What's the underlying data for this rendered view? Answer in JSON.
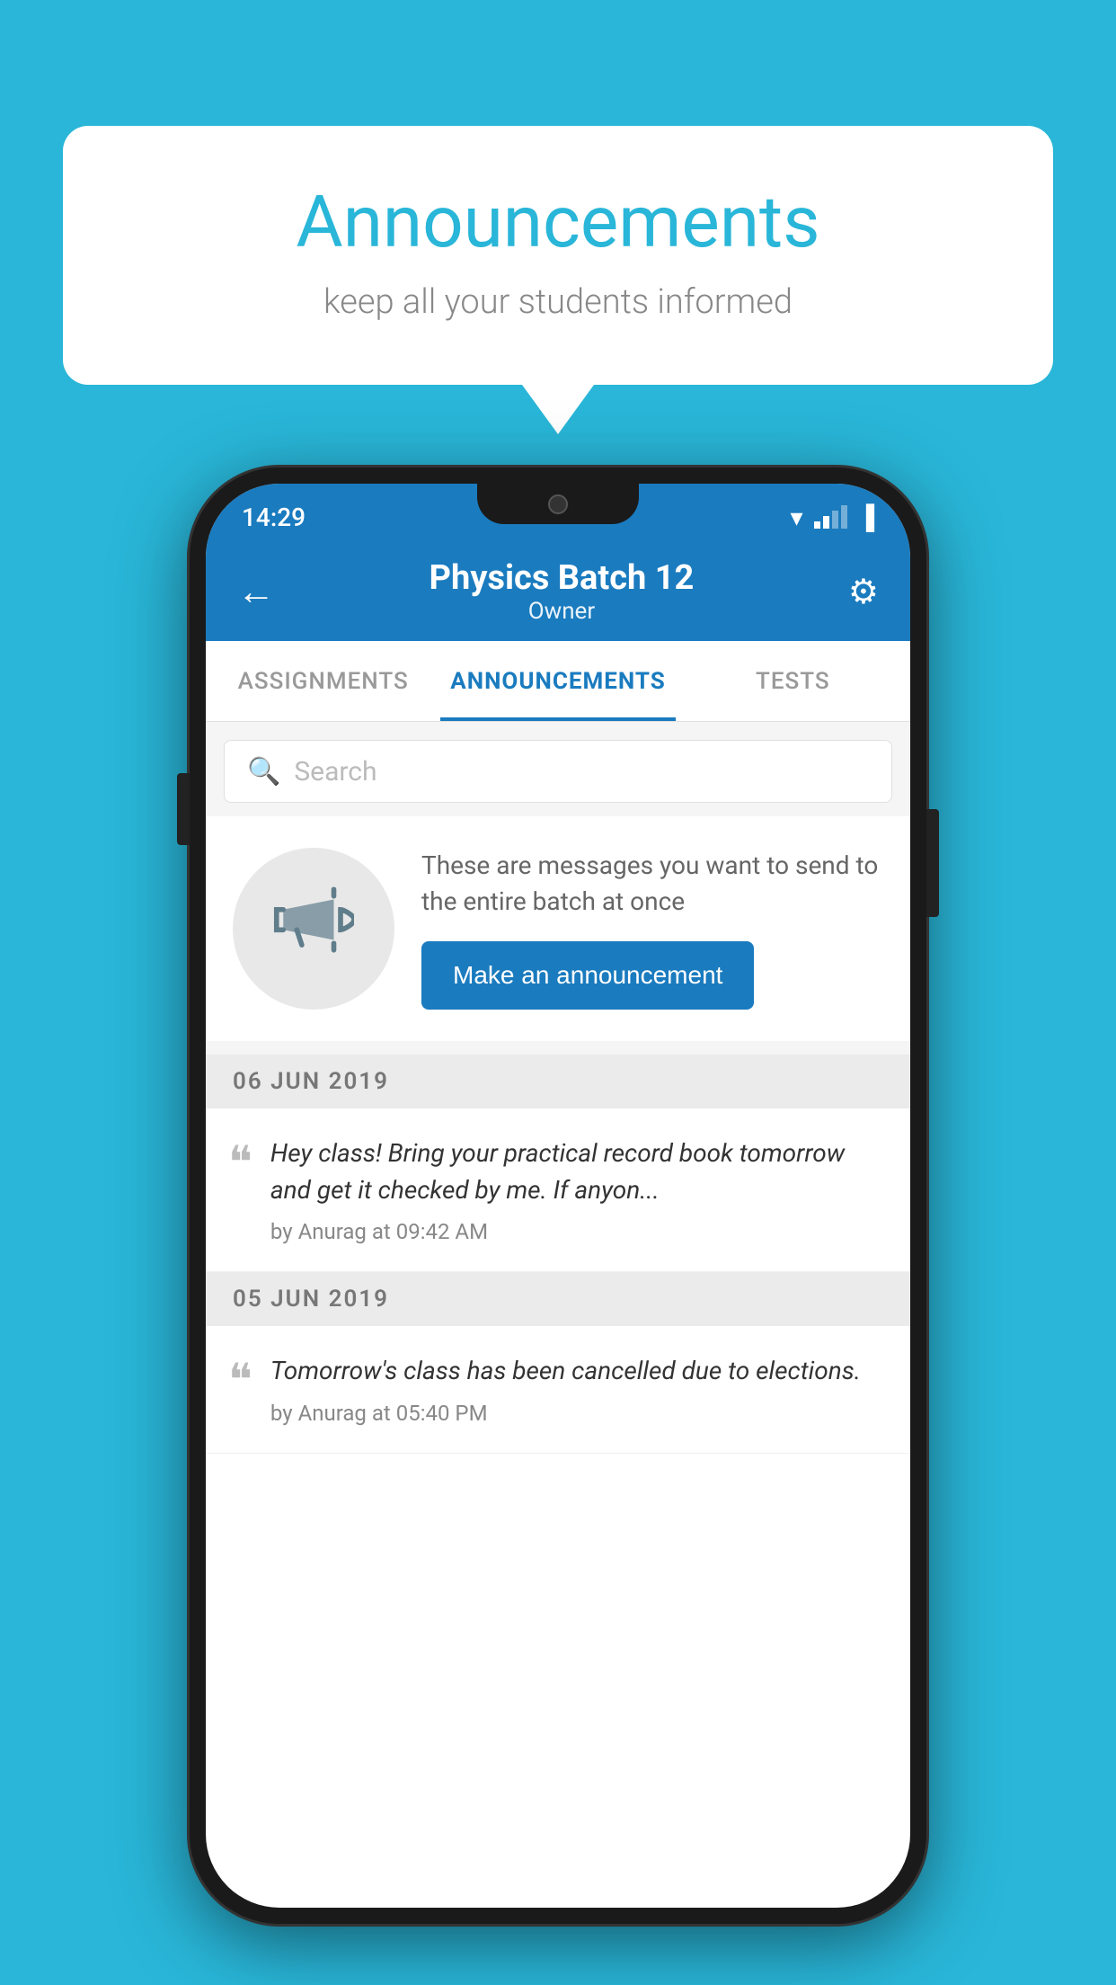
{
  "background_color": "#29b6d8",
  "speech_bubble": {
    "title": "Announcements",
    "subtitle": "keep all your students informed"
  },
  "phone": {
    "status_bar": {
      "time": "14:29"
    },
    "header": {
      "title": "Physics Batch 12",
      "subtitle": "Owner",
      "back_label": "←",
      "gear_label": "⚙"
    },
    "tabs": [
      {
        "label": "ASSIGNMENTS",
        "active": false
      },
      {
        "label": "ANNOUNCEMENTS",
        "active": true
      },
      {
        "label": "TESTS",
        "active": false
      }
    ],
    "search": {
      "placeholder": "Search"
    },
    "announcement_prompt": {
      "description": "These are messages you want to send to the entire batch at once",
      "button_label": "Make an announcement"
    },
    "announcements": [
      {
        "date": "06  JUN  2019",
        "text": "Hey class! Bring your practical record book tomorrow and get it checked by me. If anyon...",
        "meta": "by Anurag at 09:42 AM"
      },
      {
        "date": "05  JUN  2019",
        "text": "Tomorrow's class has been cancelled due to elections.",
        "meta": "by Anurag at 05:40 PM"
      }
    ]
  }
}
